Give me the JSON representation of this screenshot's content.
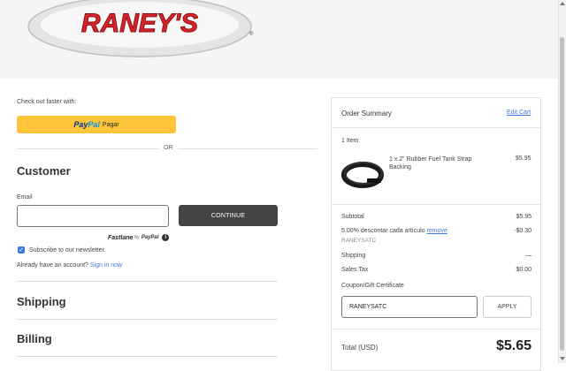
{
  "header": {
    "logo_text": "RANEY'S",
    "logo_mark": "®"
  },
  "checkout": {
    "faster_label": "Check out faster with:",
    "paypal": {
      "brand_pay": "Pay",
      "brand_pal": "Pal",
      "action": "Pagar"
    },
    "or_label": "OR"
  },
  "customer": {
    "heading": "Customer",
    "email_label": "Email",
    "email_value": "",
    "continue_label": "CONTINUE",
    "fastlane": {
      "name": "Fastlane",
      "by": "by",
      "provider": "PayPal",
      "info": "i"
    },
    "newsletter_checked": true,
    "newsletter_label": "Subscribe to our newsletter.",
    "account_prompt": "Already have an account?",
    "signin_label": "Sign in now"
  },
  "sections": {
    "shipping": "Shipping",
    "billing": "Billing"
  },
  "summary": {
    "title": "Order Summary",
    "edit_cart": "Edit Cart",
    "item_count": "1 Item",
    "item": {
      "name": "1 x 2\" Rubber Fuel Tank Strap Backing",
      "price": "$5.95"
    },
    "subtotal_label": "Subtotal",
    "subtotal_value": "$5.95",
    "discount_label": "5.00% descontar cada artículo",
    "discount_remove": "remove",
    "discount_code": "RANEYSATC",
    "discount_value": "-$0.30",
    "shipping_label": "Shipping",
    "shipping_value": "—",
    "tax_label": "Sales Tax",
    "tax_value": "$0.00",
    "coupon_label": "Coupon/Gift Certificate",
    "coupon_value": "RANEYSATC",
    "apply_label": "APPLY",
    "total_label": "Total (USD)",
    "total_value": "$5.65"
  },
  "colors": {
    "accent": "#3d7bd9",
    "paypal_yellow": "#ffc439",
    "continue_bg": "#444444",
    "logo_red": "#d8232a"
  }
}
